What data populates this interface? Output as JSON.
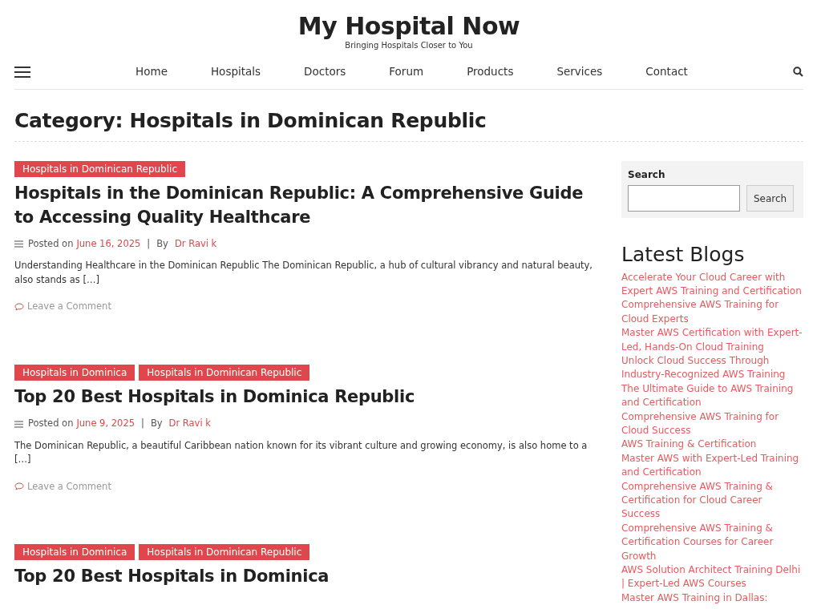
{
  "site": {
    "title": "My Hospital Now",
    "tagline": "Bringing Hospitals Closer to You"
  },
  "nav": [
    {
      "label": "Home"
    },
    {
      "label": "Hospitals"
    },
    {
      "label": "Doctors"
    },
    {
      "label": "Forum"
    },
    {
      "label": "Products"
    },
    {
      "label": "Services"
    },
    {
      "label": "Contact"
    }
  ],
  "page_title": "Category: Hospitals in Dominican Republic",
  "posts": [
    {
      "tags": [
        "Hospitals in Dominican Republic"
      ],
      "title": "Hospitals in the Dominican Republic: A Comprehensive Guide to Accessing Quality Healthcare",
      "posted_label": "Posted on",
      "date": "June 16, 2025",
      "separator": "|",
      "by_label": "By",
      "author": "Dr Ravi k",
      "excerpt": "Understanding Healthcare in the Dominican Republic The Dominican Republic, a hub of cultural vibrancy and natural beauty, also stands as […]",
      "comment_link": "Leave a Comment"
    },
    {
      "tags": [
        "Hospitals in Dominica",
        "Hospitals in Dominican Republic"
      ],
      "title": "Top 20 Best Hospitals in Dominica Republic",
      "posted_label": "Posted on",
      "date": "June 9, 2025",
      "separator": "|",
      "by_label": "By",
      "author": "Dr Ravi k",
      "excerpt": "The Dominican Republic, a beautiful Caribbean nation known for its vibrant culture and growing economy, is also home to a […]",
      "comment_link": "Leave a Comment"
    },
    {
      "tags": [
        "Hospitals in Dominica",
        "Hospitals in Dominican Republic"
      ],
      "title": "Top 20 Best Hospitals in Dominica"
    }
  ],
  "sidebar": {
    "search": {
      "label": "Search",
      "button": "Search"
    },
    "latest_title": "Latest Blogs",
    "latest": [
      "Accelerate Your Cloud Career with Expert AWS Training and Certification",
      "Comprehensive AWS Training for Cloud Experts",
      "Master AWS Certification with Expert-Led, Hands-On Cloud Training",
      "Unlock Cloud Success Through Industry-Recognized AWS Training",
      "The Ultimate Guide to AWS Training and Certification",
      "Comprehensive AWS Training for Cloud Success",
      "AWS Training & Certification",
      "Master AWS with Expert-Led Training and Certification",
      "Comprehensive AWS Training & Certification for Cloud Career Success",
      "Comprehensive AWS Training & Certification Courses for Career Growth",
      "AWS Solution Architect Training Delhi | Expert-Led AWS Courses",
      "Master AWS Training in Dallas:"
    ]
  }
}
